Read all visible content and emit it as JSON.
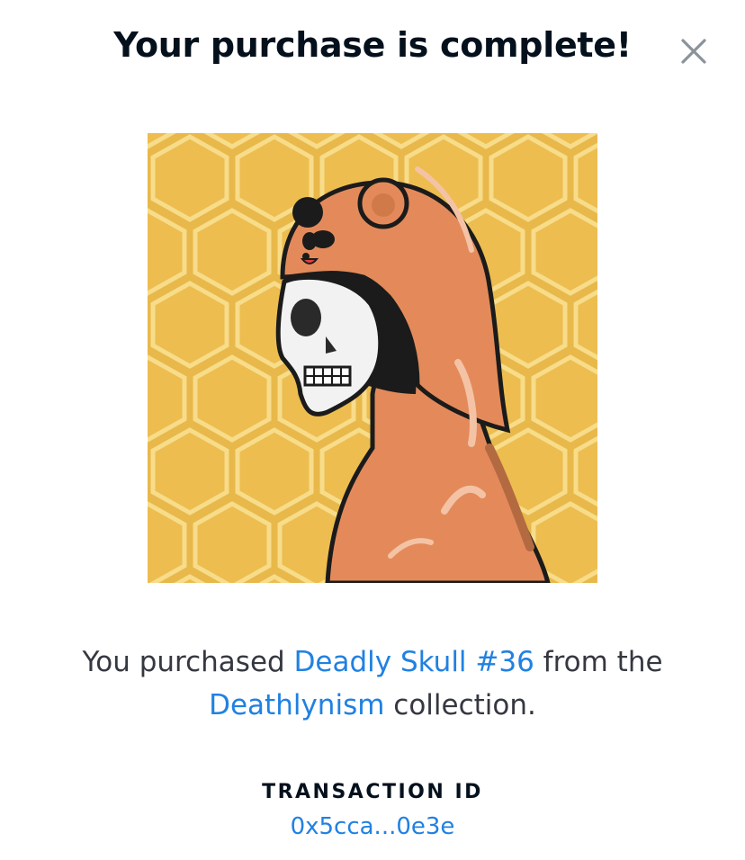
{
  "modal": {
    "title": "Your purchase is complete!",
    "close_icon": "close-icon"
  },
  "artwork": {
    "icon": "nft-artwork",
    "colors": {
      "background": "#e8b84a",
      "hood": "#e48a5a",
      "skull": "#f2f2f2"
    }
  },
  "purchase": {
    "prefix": "You purchased ",
    "item_name": "Deadly Skull #36",
    "middle": " from the",
    "collection_name": "Deathlynism",
    "suffix": " collection."
  },
  "transaction": {
    "label": "TRANSACTION ID",
    "id": "0x5cca...0e3e"
  },
  "colors": {
    "link": "#2081e2",
    "text": "#353840",
    "heading": "#04111d"
  }
}
